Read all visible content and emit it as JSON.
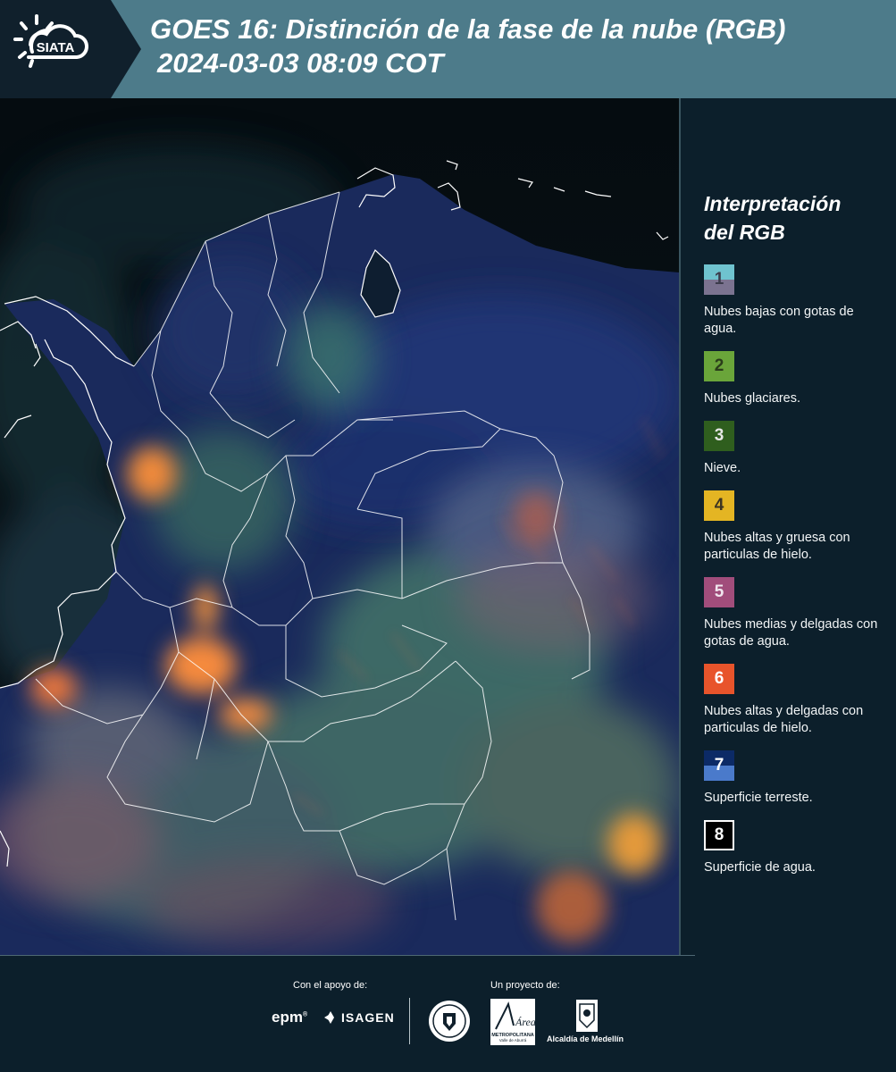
{
  "brand": {
    "logo_text": "SIATA"
  },
  "header": {
    "title_line1": "GOES 16: Distinción de la fase de la nube (RGB)",
    "title_line2": "2024-03-03 08:09 COT"
  },
  "legend": {
    "title_line1": "Interpretación",
    "title_line2": "del RGB",
    "items": [
      {
        "number": "1",
        "label": "Nubes bajas con gotas de agua.",
        "color_top": "#6fc3cf",
        "color_bottom": "#7b7390",
        "text_color": "#3c3c4c"
      },
      {
        "number": "2",
        "label": "Nubes glaciares.",
        "color": "#6aa53a",
        "text_color": "#2a3d1a"
      },
      {
        "number": "3",
        "label": "Nieve.",
        "color": "#2f5e1e",
        "text_color": "#e6e6e6"
      },
      {
        "number": "4",
        "label": "Nubes altas y gruesa con particulas de hielo.",
        "color": "#e4b523",
        "text_color": "#3c3422"
      },
      {
        "number": "5",
        "label": "Nubes medias y delgadas con gotas de agua.",
        "color": "#a14d7b",
        "text_color": "#f0e6ee"
      },
      {
        "number": "6",
        "label": "Nubes altas y delgadas con particulas de hielo.",
        "color": "#e8542b",
        "text_color": "#ffffff"
      },
      {
        "number": "7",
        "label": "Superficie terreste.",
        "color_top": "#0c2a66",
        "color_bottom": "#4a7acb",
        "text_color": "#ffffff"
      },
      {
        "number": "8",
        "label": "Superficie de agua.",
        "color": "#000000",
        "border": "#ffffff",
        "text_color": "#ffffff"
      }
    ]
  },
  "footer": {
    "support_label": "Con el apoyo de:",
    "project_label": "Un proyecto de:",
    "sponsors": [
      "epm",
      "ISAGEN"
    ],
    "area_logo_text": "Área",
    "area_logo_subtext": "METROPOLITANA",
    "area_logo_subtext2": "Valle de Aburrá",
    "alcaldia_text": "Alcaldía de Medellín"
  }
}
